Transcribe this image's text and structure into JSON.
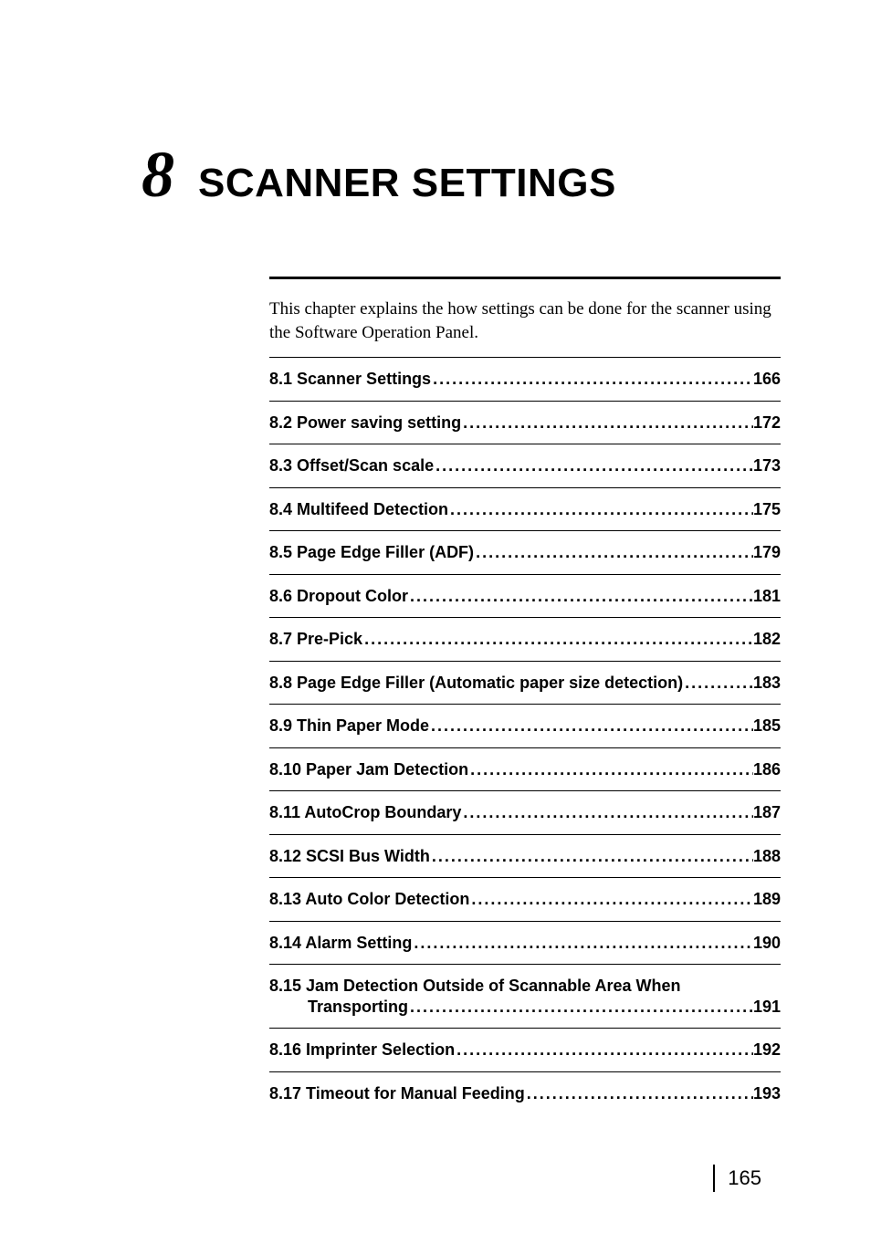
{
  "chapter": {
    "number": "8",
    "title": "SCANNER SETTINGS"
  },
  "intro": "This chapter explains the how settings can be done for the scanner using the Software Operation Panel.",
  "toc": [
    {
      "label": "8.1 Scanner Settings",
      "page": "166"
    },
    {
      "label": "8.2 Power saving setting",
      "page": "172"
    },
    {
      "label": "8.3 Offset/Scan scale",
      "page": "173"
    },
    {
      "label": "8.4 Multifeed Detection",
      "page": "175"
    },
    {
      "label": "8.5 Page Edge Filler (ADF)",
      "page": "179"
    },
    {
      "label": "8.6 Dropout Color",
      "page": "181"
    },
    {
      "label": "8.7 Pre-Pick",
      "page": "182"
    },
    {
      "label": "8.8 Page Edge Filler (Automatic paper size detection)",
      "page": "183"
    },
    {
      "label": "8.9 Thin Paper Mode",
      "page": "185"
    },
    {
      "label": "8.10 Paper Jam Detection",
      "page": "186"
    },
    {
      "label": "8.11 AutoCrop Boundary",
      "page": "187"
    },
    {
      "label": "8.12 SCSI Bus Width",
      "page": "188"
    },
    {
      "label": "8.13 Auto Color Detection",
      "page": "189"
    },
    {
      "label": "8.14 Alarm Setting",
      "page": "190"
    },
    {
      "label_line1": "8.15 Jam Detection Outside of Scannable Area When",
      "label_line2": "Transporting",
      "page": "191",
      "multiline": true
    },
    {
      "label": "8.16 Imprinter Selection",
      "page": "192"
    },
    {
      "label": "8.17 Timeout for Manual Feeding",
      "page": "193"
    }
  ],
  "page_number": "165"
}
